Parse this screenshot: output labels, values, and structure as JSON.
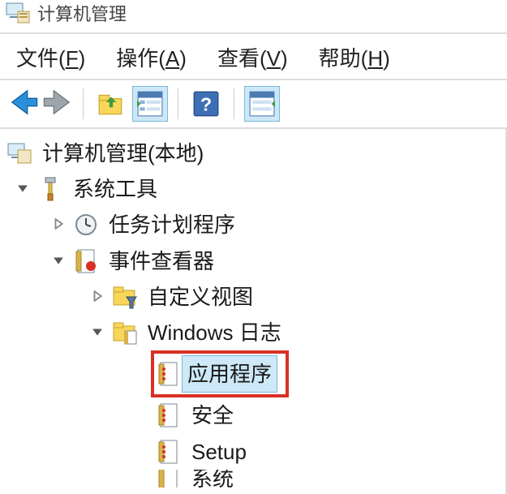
{
  "window": {
    "title": "计算机管理"
  },
  "menubar": {
    "file": {
      "label": "文件",
      "accel": "F"
    },
    "action": {
      "label": "操作",
      "accel": "A"
    },
    "view": {
      "label": "查看",
      "accel": "V"
    },
    "help": {
      "label": "帮助",
      "accel": "H"
    }
  },
  "toolbar": {
    "back": "back-arrow",
    "forward": "forward-arrow",
    "up": "up-folder",
    "details": "details-view",
    "help": "help-icon",
    "refresh": "refresh-view"
  },
  "tree": {
    "root": "计算机管理(本地)",
    "system_tools": "系统工具",
    "task_scheduler": "任务计划程序",
    "event_viewer": "事件查看器",
    "custom_views": "自定义视图",
    "windows_logs": "Windows 日志",
    "application": "应用程序",
    "security": "安全",
    "setup": "Setup",
    "system": "系统"
  }
}
